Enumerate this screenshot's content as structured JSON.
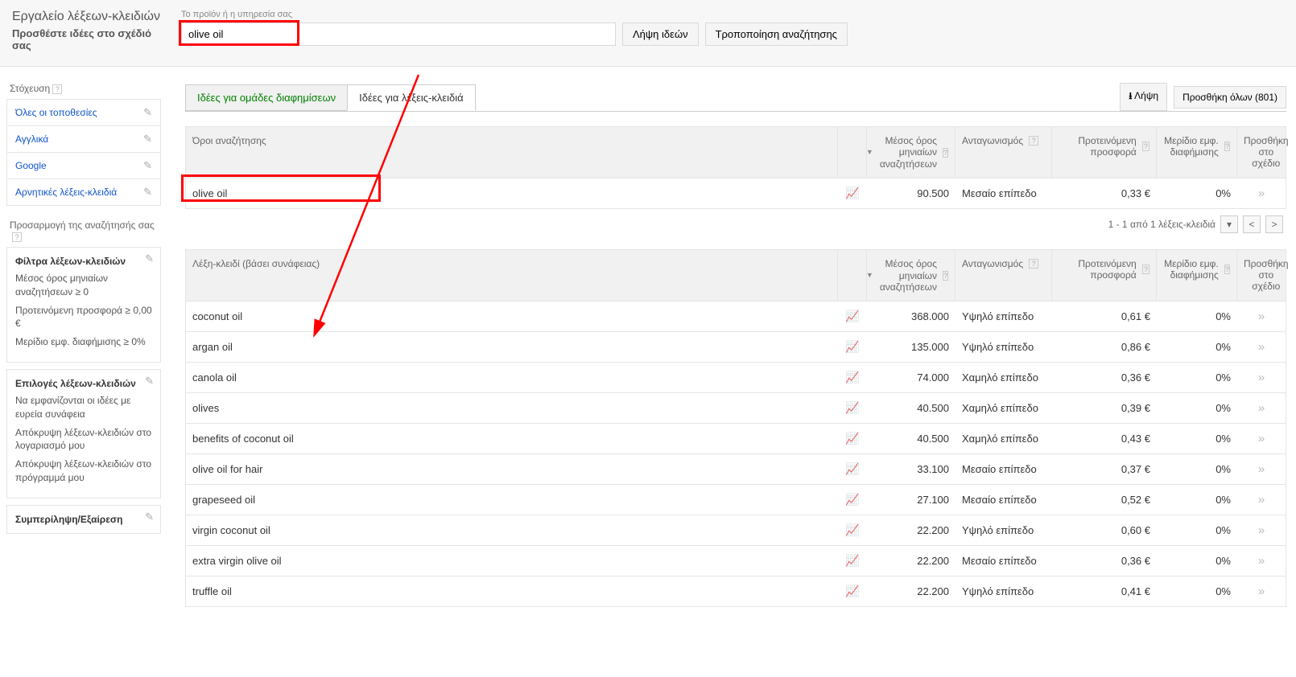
{
  "header": {
    "title": "Εργαλείο λέξεων-κλειδιών",
    "subtitle": "Προσθέστε ιδέες στο σχέδιό σας",
    "field_label": "Το προϊόν ή η υπηρεσία σας",
    "search_value": "olive oil",
    "get_ideas": "Λήψη ιδεών",
    "modify_search": "Τροποποίηση αναζήτησης"
  },
  "sidebar": {
    "targeting_title": "Στόχευση",
    "targeting": [
      "Όλες οι τοποθεσίες",
      "Αγγλικά",
      "Google",
      "Αρνητικές λέξεις-κλειδιά"
    ],
    "customize_title": "Προσαρμογή της αναζήτησής σας",
    "filters": {
      "title": "Φίλτρα λέξεων-κλειδιών",
      "line1": "Μέσος όρος μηνιαίων αναζητήσεων ≥ 0",
      "line2": "Προτεινόμενη προσφορά ≥ 0,00 €",
      "line3": "Μερίδιο εμφ. διαφήμισης ≥ 0%"
    },
    "options": {
      "title": "Επιλογές λέξεων-κλειδιών",
      "line1": "Να εμφανίζονται οι ιδέες με ευρεία συνάφεια",
      "line2": "Απόκρυψη λέξεων-κλειδιών στο λογαριασμό μου",
      "line3": "Απόκρυψη λέξεων-κλειδιών στο πρόγραμμά μου"
    },
    "include_exclude": "Συμπερίληψη/Εξαίρεση"
  },
  "tabs": {
    "adgroup": "Ιδέες για ομάδες διαφημίσεων",
    "keyword": "Ιδέες για λέξεις-κλειδιά",
    "download": "Λήψη",
    "add_all": "Προσθήκη όλων (801)"
  },
  "headers": {
    "search_terms": "Όροι αναζήτησης",
    "keyword_relevance": "Λέξη-κλειδί (βάσει συνάφειας)",
    "avg_monthly": "Μέσος όρος μηνιαίων αναζητήσεων",
    "competition": "Ανταγωνισμός",
    "suggested_bid": "Προτεινόμενη προσφορά",
    "ad_share": "Μερίδιο εμφ. διαφήμισης",
    "add_to_plan": "Προσθήκη στο σχέδιο"
  },
  "pager": "1 - 1 από 1 λέξεις-κλειδιά",
  "search_terms_rows": [
    {
      "kw": "olive oil",
      "searches": "90.500",
      "comp": "Μεσαίο επίπεδο",
      "bid": "0,33 €",
      "share": "0%"
    }
  ],
  "keyword_rows": [
    {
      "kw": "coconut oil",
      "searches": "368.000",
      "comp": "Υψηλό επίπεδο",
      "bid": "0,61 €",
      "share": "0%"
    },
    {
      "kw": "argan oil",
      "searches": "135.000",
      "comp": "Υψηλό επίπεδο",
      "bid": "0,86 €",
      "share": "0%"
    },
    {
      "kw": "canola oil",
      "searches": "74.000",
      "comp": "Χαμηλό επίπεδο",
      "bid": "0,36 €",
      "share": "0%"
    },
    {
      "kw": "olives",
      "searches": "40.500",
      "comp": "Χαμηλό επίπεδο",
      "bid": "0,39 €",
      "share": "0%"
    },
    {
      "kw": "benefits of coconut oil",
      "searches": "40.500",
      "comp": "Χαμηλό επίπεδο",
      "bid": "0,43 €",
      "share": "0%"
    },
    {
      "kw": "olive oil for hair",
      "searches": "33.100",
      "comp": "Μεσαίο επίπεδο",
      "bid": "0,37 €",
      "share": "0%"
    },
    {
      "kw": "grapeseed oil",
      "searches": "27.100",
      "comp": "Μεσαίο επίπεδο",
      "bid": "0,52 €",
      "share": "0%"
    },
    {
      "kw": "virgin coconut oil",
      "searches": "22.200",
      "comp": "Υψηλό επίπεδο",
      "bid": "0,60 €",
      "share": "0%"
    },
    {
      "kw": "extra virgin olive oil",
      "searches": "22.200",
      "comp": "Μεσαίο επίπεδο",
      "bid": "0,36 €",
      "share": "0%"
    },
    {
      "kw": "truffle oil",
      "searches": "22.200",
      "comp": "Υψηλό επίπεδο",
      "bid": "0,41 €",
      "share": "0%"
    }
  ]
}
